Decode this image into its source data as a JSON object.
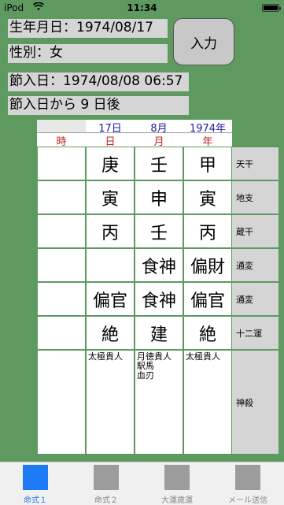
{
  "status": {
    "carrier": "iPod",
    "time": "11:34"
  },
  "info": {
    "birth": "生年月日：1974/08/17",
    "gender": "性別：女",
    "setsuiri": "節入日：1974/08/08 06:57",
    "after": "節入日から 9 日後"
  },
  "input_button": "入力",
  "header": {
    "top": [
      "17日",
      "8月",
      "1974年"
    ],
    "bottom": [
      "時",
      "日",
      "月",
      "年"
    ]
  },
  "rows": [
    {
      "label": "天干",
      "cells": [
        "",
        "庚",
        "壬",
        "甲"
      ]
    },
    {
      "label": "地支",
      "cells": [
        "",
        "寅",
        "申",
        "寅"
      ]
    },
    {
      "label": "蔵干",
      "cells": [
        "",
        "丙",
        "壬",
        "丙"
      ]
    },
    {
      "label": "通変",
      "cells": [
        "",
        "",
        "食神",
        "偏財"
      ]
    },
    {
      "label": "通変",
      "cells": [
        "",
        "偏官",
        "食神",
        "偏官"
      ]
    },
    {
      "label": "十二運",
      "cells": [
        "",
        "絶",
        "建",
        "絶"
      ]
    },
    {
      "label": "神殺",
      "cells": [
        "",
        "太極貴人",
        "月徳貴人\n駅馬\n血刃",
        "太極貴人"
      ]
    }
  ],
  "tabs": [
    {
      "label": "命式１",
      "active": true
    },
    {
      "label": "命式２",
      "active": false
    },
    {
      "label": "大運歳運",
      "active": false
    },
    {
      "label": "メール送信",
      "active": false
    }
  ]
}
